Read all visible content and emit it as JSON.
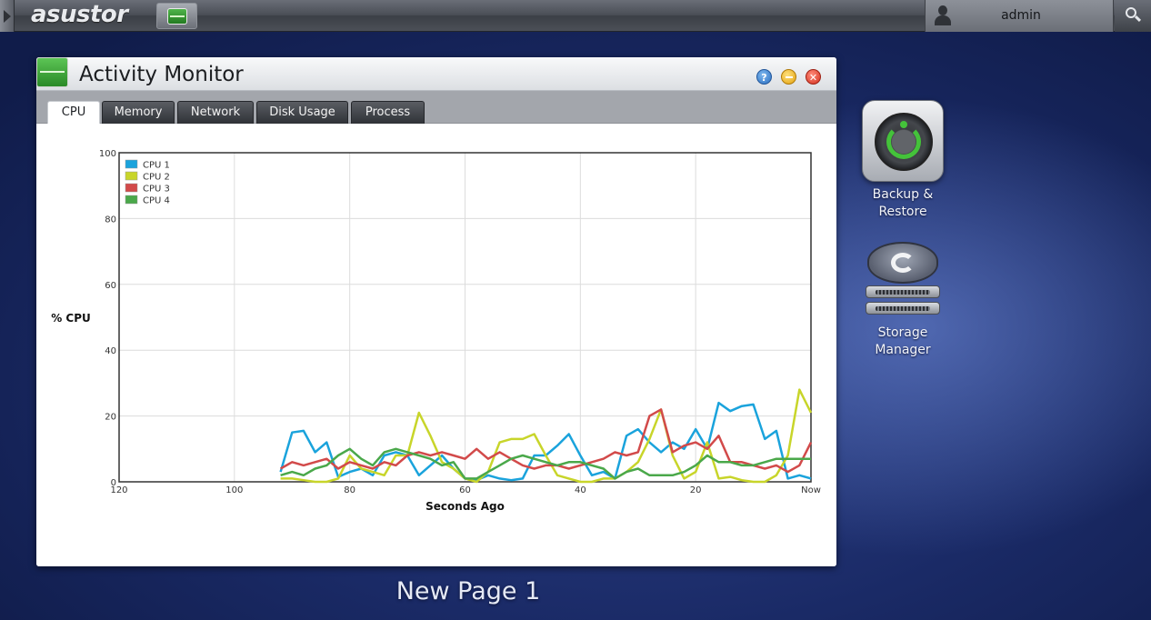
{
  "taskbar": {
    "logo": "asustor",
    "username": "admin"
  },
  "window": {
    "title": "Activity Monitor",
    "tabs": [
      {
        "label": "CPU",
        "active": true
      },
      {
        "label": "Memory",
        "active": false
      },
      {
        "label": "Network",
        "active": false
      },
      {
        "label": "Disk Usage",
        "active": false
      },
      {
        "label": "Process",
        "active": false
      }
    ]
  },
  "desktop": {
    "icons": [
      {
        "label_line1": "Backup &",
        "label_line2": "Restore"
      },
      {
        "label_line1": "Storage",
        "label_line2": "Manager"
      }
    ],
    "page_label": "New Page 1"
  },
  "chart_data": {
    "type": "line",
    "xlabel": "Seconds Ago",
    "ylabel": "% CPU",
    "xlim": [
      120,
      0
    ],
    "ylim": [
      0,
      100
    ],
    "x_ticks": [
      "120",
      "100",
      "80",
      "60",
      "40",
      "20",
      "Now"
    ],
    "y_ticks": [
      "0",
      "20",
      "40",
      "60",
      "80",
      "100"
    ],
    "grid": true,
    "legend_position": "top-left",
    "x": [
      92,
      90,
      88,
      86,
      84,
      82,
      80,
      78,
      76,
      74,
      72,
      70,
      68,
      66,
      64,
      62,
      60,
      58,
      56,
      54,
      52,
      50,
      48,
      46,
      44,
      42,
      40,
      38,
      36,
      34,
      32,
      30,
      28,
      26,
      24,
      22,
      20,
      18,
      16,
      14,
      12,
      10,
      8,
      6,
      4,
      2,
      0
    ],
    "series": [
      {
        "name": "CPU 1",
        "color": "#1aa3dc",
        "values": [
          3,
          15,
          15.5,
          9,
          12,
          1.5,
          3,
          4,
          2,
          8,
          9,
          8,
          2,
          5,
          8,
          4,
          1,
          0.5,
          2,
          1,
          0.5,
          1,
          8,
          8,
          11,
          14.5,
          8,
          2,
          3,
          1,
          14,
          16,
          12,
          9,
          12,
          10,
          16,
          10,
          24,
          21.5,
          23,
          23.5,
          13,
          15.5,
          1,
          2,
          1
        ]
      },
      {
        "name": "CPU 2",
        "color": "#c8d52a",
        "values": [
          1,
          1,
          0.5,
          0,
          0,
          1,
          8,
          4,
          3,
          2,
          8,
          8,
          21,
          14,
          6,
          4,
          1,
          0,
          3,
          12,
          13,
          13,
          14.5,
          8,
          2,
          1,
          0,
          0,
          1,
          1,
          3,
          6,
          13,
          22,
          8,
          1,
          3,
          12,
          1,
          1.5,
          0.5,
          0,
          0,
          2,
          8,
          28,
          21
        ]
      },
      {
        "name": "CPU 3",
        "color": "#d24a4a",
        "values": [
          4,
          6,
          5,
          6,
          7,
          4,
          6,
          5,
          4,
          6,
          5,
          8,
          9,
          8,
          9,
          8,
          7,
          10,
          7,
          9,
          7,
          5,
          4,
          5,
          5,
          4,
          5,
          6,
          7,
          9,
          8,
          9,
          20,
          22,
          9,
          11,
          12,
          10,
          14,
          6,
          6,
          5,
          4,
          5,
          3,
          5,
          12
        ]
      },
      {
        "name": "CPU 4",
        "color": "#4aa84a",
        "values": [
          2,
          3,
          2,
          4,
          5,
          8,
          10,
          7,
          5,
          9,
          10,
          9,
          8,
          7,
          5,
          6,
          1,
          1,
          3,
          5,
          7,
          8,
          7,
          6,
          5,
          6,
          6,
          5,
          4,
          1,
          3,
          4,
          2,
          2,
          2,
          3,
          5,
          8,
          6,
          6,
          5,
          5,
          6,
          7,
          7,
          7,
          7
        ]
      }
    ]
  }
}
